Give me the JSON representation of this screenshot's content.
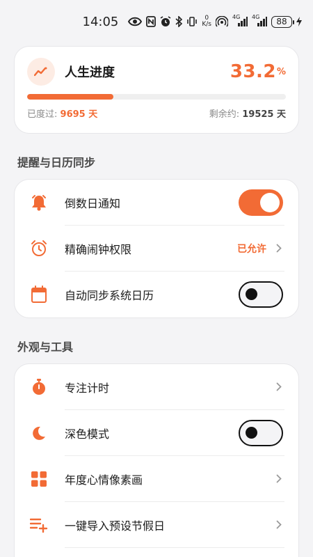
{
  "status_bar": {
    "time": "14:05",
    "net_speed_value": "0",
    "net_speed_unit": "K/s",
    "signal1_label": "4G",
    "signal2_label": "4G",
    "battery": "88"
  },
  "progress": {
    "title": "人生进度",
    "percent": "33.2",
    "percent_sign": "%",
    "fill_fraction": 0.332,
    "passed_label": "已度过:",
    "passed_value": "9695 天",
    "remaining_label": "剩余约:",
    "remaining_value": "19525 天"
  },
  "sections": {
    "sync": {
      "title": "提醒与日历同步",
      "countdown_label": "倒数日通知",
      "alarm_label": "精确闹钟权限",
      "alarm_status": "已允许",
      "calendar_label": "自动同步系统日历"
    },
    "tools": {
      "title": "外观与工具",
      "focus_label": "专注计时",
      "dark_label": "深色模式",
      "mood_label": "年度心情像素画",
      "holiday_label": "一键导入预设节假日"
    }
  },
  "colors": {
    "accent": "#f26b35",
    "background": "#f4f4f6"
  },
  "icons": {
    "progress": "trend-line-icon",
    "countdown": "bell-icon",
    "alarm": "alarm-clock-icon",
    "calendar": "calendar-icon",
    "focus": "stopwatch-icon",
    "dark": "moon-icon",
    "mood": "grid-icon",
    "holiday": "list-add-icon"
  },
  "toggles": {
    "countdown_notify": true,
    "calendar_sync": false,
    "dark_mode": false
  }
}
